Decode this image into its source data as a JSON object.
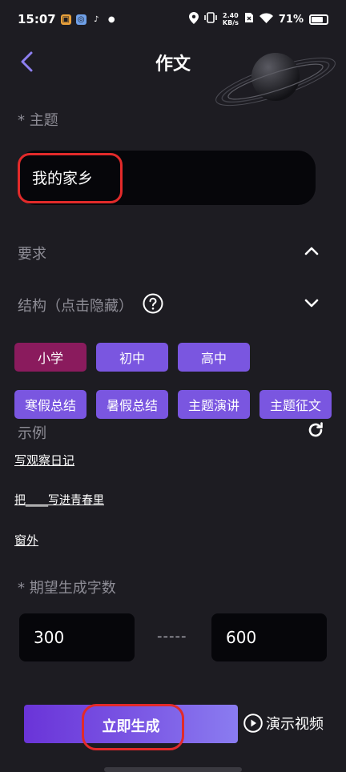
{
  "status_bar": {
    "time": "15:07",
    "net_speed_value": "2.40",
    "net_speed_unit": "KB/s",
    "battery": "71%"
  },
  "header": {
    "title": "作文"
  },
  "topic": {
    "label": "* 主题",
    "value": "我的家乡"
  },
  "requirements": {
    "label": "要求"
  },
  "structure": {
    "label": "结构（点击隐藏）"
  },
  "levels": [
    "小学",
    "初中",
    "高中"
  ],
  "types": [
    "寒假总结",
    "暑假总结",
    "主题演讲",
    "主题征文"
  ],
  "examples": {
    "label": "示例",
    "items": [
      "写观察日记",
      "把____写进青春里",
      "窗外"
    ]
  },
  "word_count": {
    "label": "* 期望生成字数",
    "min": "300",
    "separator": "-----",
    "max": "600"
  },
  "actions": {
    "generate_label": "立即生成",
    "demo_label": "演示视频"
  },
  "colors": {
    "accent": "#7a56e0",
    "selected_chip": "#8a1b5d",
    "annotation": "#e22a2a"
  }
}
